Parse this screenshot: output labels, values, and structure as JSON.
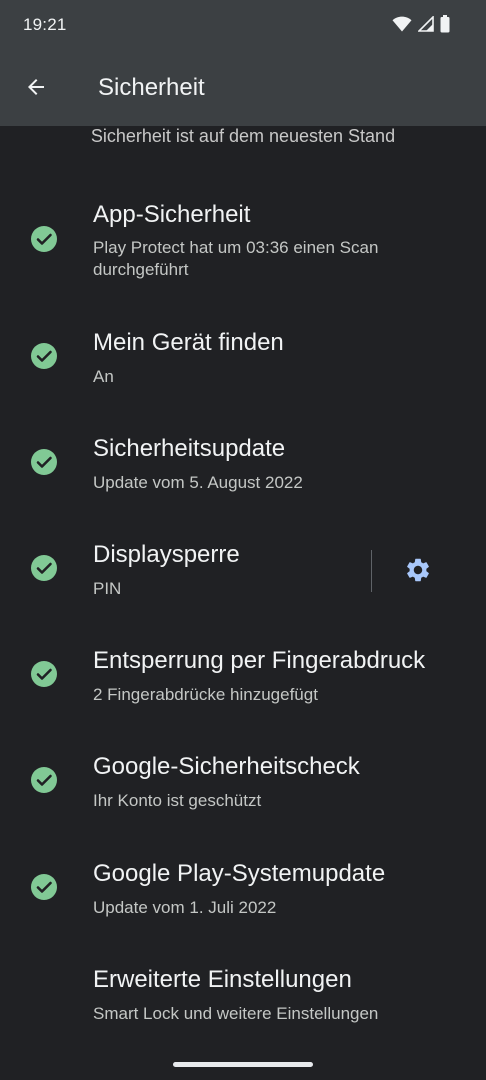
{
  "status": {
    "time": "19:21"
  },
  "header": {
    "title": "Sicherheit"
  },
  "summary": "Sicherheit ist auf dem neuesten Stand",
  "items": [
    {
      "title": "App-Sicherheit",
      "subtitle": "Play Protect hat um 03:36 einen Scan durchgeführt",
      "status_icon": "check-circle-icon"
    },
    {
      "title": "Mein Gerät finden",
      "subtitle": "An",
      "status_icon": "check-circle-icon"
    },
    {
      "title": "Sicherheitsupdate",
      "subtitle": "Update vom 5. August 2022",
      "status_icon": "check-circle-icon"
    },
    {
      "title": "Displaysperre",
      "subtitle": "PIN",
      "status_icon": "check-circle-icon",
      "action_icon": "gear-icon"
    },
    {
      "title": "Entsperrung per Fingerabdruck",
      "subtitle": "2 Fingerabdrücke hinzugefügt",
      "status_icon": "check-circle-icon"
    },
    {
      "title": "Google-Sicherheitscheck",
      "subtitle": "Ihr Konto ist geschützt",
      "status_icon": "check-circle-icon"
    },
    {
      "title": "Google Play-Systemupdate",
      "subtitle": "Update vom 1. Juli 2022",
      "status_icon": "check-circle-icon"
    },
    {
      "title": "Erweiterte Einstellungen",
      "subtitle": "Smart Lock und weitere Einstellungen"
    }
  ],
  "colors": {
    "background": "#202124",
    "app_bar": "#3c4043",
    "check_green": "#81c995",
    "primary_text": "#f1f3f4",
    "secondary_text": "#c4c7c5"
  }
}
